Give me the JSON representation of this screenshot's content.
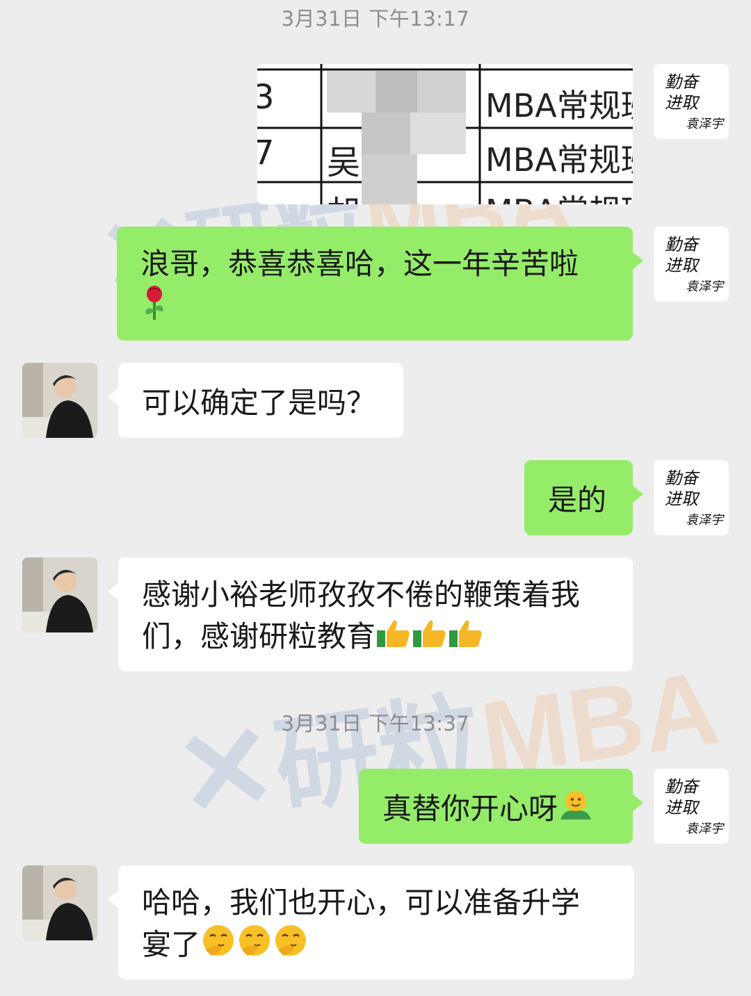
{
  "timestamps": [
    "3月31日 下午13:17",
    "3月31日 下午13:37"
  ],
  "image_message": {
    "col1": [
      "3",
      "7",
      ""
    ],
    "col2": [
      "",
      "吴",
      "胡"
    ],
    "col3": [
      "MBA常规班",
      "MBA常规班",
      "MBA常规班"
    ]
  },
  "messages": [
    {
      "text": "浪哥，恭喜恭喜哈，这一年辛苦啦",
      "text2": ""
    },
    {
      "text": "可以确定了是吗？"
    },
    {
      "text": "是的"
    },
    {
      "text": "感谢小裕老师孜孜不倦的鞭策着我",
      "text2": "们，感谢研粒教育"
    },
    {
      "text": "真替你开心呀"
    },
    {
      "text": "哈哈，我们也开心，可以准备升学",
      "text2": "宴了"
    }
  ],
  "self_avatar": {
    "line1": "勤奋",
    "line2": "进取",
    "signature": "袁泽宇"
  },
  "watermark": {
    "brand": "研粒",
    "suffix": "MBA"
  },
  "colors": {
    "bg": "#ededed",
    "self_bubble": "#95ec69",
    "peer_bubble": "#ffffff",
    "timestamp": "#8c8c8c",
    "watermark_blue": "#3f6fb6",
    "watermark_orange": "#f08a2a"
  },
  "icons": [
    "rose-emoji",
    "thumbs-up-emoji",
    "hug-face-emoji",
    "thinking-face-emoji"
  ]
}
